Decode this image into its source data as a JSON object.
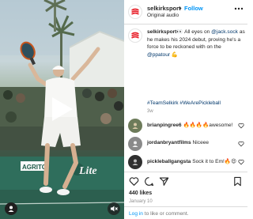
{
  "post": {
    "username": "selkirksport",
    "separator": "•",
    "follow_label": "Follow",
    "audio_label": "Original audio",
    "caption": {
      "username": "selkirksport",
      "emoji_eyes": "👀",
      "part1": " All eyes on ",
      "mention1": "@jack.sock",
      "part2": " as he makes his 2024 debut, proving he's a force to be reckoned with on the ",
      "mention2": "@ppatour",
      "emoji_muscle": " 💪",
      "hashtags": "#TeamSelkirk #WeArePickleball",
      "time": "3w"
    },
    "comments": [
      {
        "username": "brianpingree6",
        "text": "🔥🔥🔥🔥awesome!",
        "avatar_color": "#6d7b5a"
      },
      {
        "username": "jordanbryantfilms",
        "text": "Niceee",
        "avatar_color": "#8a8a8a"
      },
      {
        "username": "pickleballgangsta",
        "text": "Sock it to Em!🔥😍",
        "avatar_color": "#2f2f2f"
      }
    ],
    "likes": "440 likes",
    "date": "January 10",
    "login_prompt": {
      "link": "Log in",
      "rest": " to like or comment."
    }
  },
  "media": {
    "banner_brand": "AGRITO",
    "banner_beer": "Lite"
  },
  "icons": {
    "more": "more-options-icon",
    "like": "heart-icon",
    "comment": "comment-icon",
    "share": "share-icon",
    "save": "bookmark-icon",
    "play": "play-icon",
    "mute": "speaker-muted-icon"
  },
  "colors": {
    "brand_red": "#e8202a",
    "link_blue": "#0095f6",
    "mention_blue": "#00376b",
    "muted_text": "#8e8e8e"
  }
}
